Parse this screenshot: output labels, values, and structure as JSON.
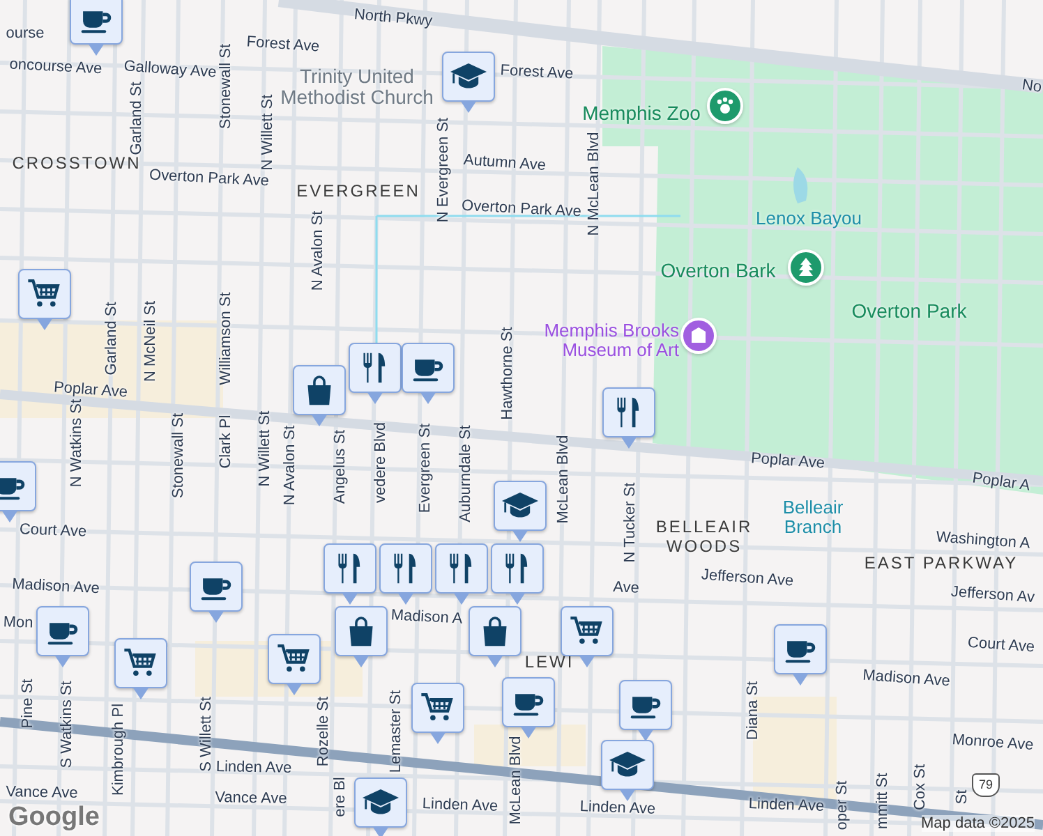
{
  "labels": [
    {
      "text": "ourse",
      "kind": "street"
    },
    {
      "text": "North Pkwy",
      "kind": "street"
    },
    {
      "text": "No",
      "kind": "street"
    },
    {
      "text": "Forest Ave",
      "kind": "street"
    },
    {
      "text": "Forest Ave",
      "kind": "street"
    },
    {
      "text": "oncourse Ave",
      "kind": "street"
    },
    {
      "text": "Galloway Ave",
      "kind": "street"
    },
    {
      "text": "Garland St",
      "kind": "street"
    },
    {
      "text": "Stonewall St",
      "kind": "street"
    },
    {
      "text": "N Willett St",
      "kind": "street"
    },
    {
      "text": "Autumn Ave",
      "kind": "street"
    },
    {
      "text": "Overton Park Ave",
      "kind": "street"
    },
    {
      "text": "Overton Park Ave",
      "kind": "street"
    },
    {
      "text": "N Evergreen St",
      "kind": "street"
    },
    {
      "text": "N McLean Blvd",
      "kind": "street"
    },
    {
      "text": "N Avalon St",
      "kind": "street"
    },
    {
      "text": "Garland St",
      "kind": "street"
    },
    {
      "text": "N McNeil St",
      "kind": "street"
    },
    {
      "text": "Williamson St",
      "kind": "street"
    },
    {
      "text": "Hawthorne St",
      "kind": "street"
    },
    {
      "text": "Poplar Ave",
      "kind": "street"
    },
    {
      "text": "Poplar Ave",
      "kind": "street"
    },
    {
      "text": "Poplar A",
      "kind": "street"
    },
    {
      "text": "N Watkins St",
      "kind": "street"
    },
    {
      "text": "Stonewall St",
      "kind": "street"
    },
    {
      "text": "Clark Pl",
      "kind": "street"
    },
    {
      "text": "N Willett St",
      "kind": "street"
    },
    {
      "text": "N Avalon St",
      "kind": "street"
    },
    {
      "text": "Angelus St",
      "kind": "street"
    },
    {
      "text": "vedere Blvd",
      "kind": "street"
    },
    {
      "text": "Evergreen St",
      "kind": "street"
    },
    {
      "text": "Auburndale St",
      "kind": "street"
    },
    {
      "text": "McLean Blvd",
      "kind": "street"
    },
    {
      "text": "N Tucker St",
      "kind": "street"
    },
    {
      "text": "Court Ave",
      "kind": "street"
    },
    {
      "text": "Madison Ave",
      "kind": "street"
    },
    {
      "text": "Mon",
      "kind": "street"
    },
    {
      "text": "Madison A",
      "kind": "street"
    },
    {
      "text": "Ave",
      "kind": "street"
    },
    {
      "text": "Jefferson Ave",
      "kind": "street"
    },
    {
      "text": "Washington A",
      "kind": "street"
    },
    {
      "text": "Jefferson Av",
      "kind": "street"
    },
    {
      "text": "Court Ave",
      "kind": "street"
    },
    {
      "text": "Madison Ave",
      "kind": "street"
    },
    {
      "text": "Monroe Ave",
      "kind": "street"
    },
    {
      "text": "Pine St",
      "kind": "street"
    },
    {
      "text": "S Watkins St",
      "kind": "street"
    },
    {
      "text": "Kimbrough Pl",
      "kind": "street"
    },
    {
      "text": "S Willett St",
      "kind": "street"
    },
    {
      "text": "Linden Ave",
      "kind": "street"
    },
    {
      "text": "Vance Ave",
      "kind": "street"
    },
    {
      "text": "Vance Ave",
      "kind": "street"
    },
    {
      "text": "Rozelle St",
      "kind": "street"
    },
    {
      "text": "Lemaster St",
      "kind": "street"
    },
    {
      "text": "ere Bl",
      "kind": "street"
    },
    {
      "text": "Linden Ave",
      "kind": "street"
    },
    {
      "text": "McLean Blvd",
      "kind": "street"
    },
    {
      "text": "Linden Ave",
      "kind": "street"
    },
    {
      "text": "Linden Ave",
      "kind": "street"
    },
    {
      "text": "Diana St",
      "kind": "street"
    },
    {
      "text": "oper St",
      "kind": "street"
    },
    {
      "text": "mmitt St",
      "kind": "street"
    },
    {
      "text": "Cox St",
      "kind": "street"
    },
    {
      "text": "St",
      "kind": "street"
    },
    {
      "text": "CROSSTOWN",
      "kind": "neighborhood"
    },
    {
      "text": "EVERGREEN",
      "kind": "neighborhood"
    },
    {
      "text": "BELLEAIR WOODS",
      "kind": "neighborhood"
    },
    {
      "text": "EAST PARKWAY",
      "kind": "neighborhood"
    },
    {
      "text": "LEWI",
      "kind": "neighborhood"
    },
    {
      "text": "Trinity United Methodist Church",
      "kind": "place"
    },
    {
      "text": "Memphis Zoo",
      "kind": "park"
    },
    {
      "text": "Lenox Bayou",
      "kind": "water"
    },
    {
      "text": "Overton Bark",
      "kind": "park"
    },
    {
      "text": "Overton Park",
      "kind": "park"
    },
    {
      "text": "Memphis Brooks Museum of Art",
      "kind": "museum"
    },
    {
      "text": "Belleair Branch",
      "kind": "water"
    }
  ],
  "places": [
    {
      "kind": "zoo"
    },
    {
      "kind": "park"
    },
    {
      "kind": "museum"
    }
  ],
  "markers": [
    {
      "kind": "coffee"
    },
    {
      "kind": "school"
    },
    {
      "kind": "cart"
    },
    {
      "kind": "bag"
    },
    {
      "kind": "dining"
    },
    {
      "kind": "coffee"
    },
    {
      "kind": "dining"
    },
    {
      "kind": "coffee"
    },
    {
      "kind": "school"
    },
    {
      "kind": "coffee"
    },
    {
      "kind": "coffee"
    },
    {
      "kind": "cart"
    },
    {
      "kind": "cart"
    },
    {
      "kind": "dining"
    },
    {
      "kind": "dining"
    },
    {
      "kind": "dining"
    },
    {
      "kind": "dining"
    },
    {
      "kind": "bag"
    },
    {
      "kind": "bag"
    },
    {
      "kind": "cart"
    },
    {
      "kind": "coffee"
    },
    {
      "kind": "coffee"
    },
    {
      "kind": "cart"
    },
    {
      "kind": "coffee"
    },
    {
      "kind": "school"
    },
    {
      "kind": "school"
    }
  ],
  "highway_shield": "79",
  "logo": "Google",
  "attribution": "Map data ©2025"
}
